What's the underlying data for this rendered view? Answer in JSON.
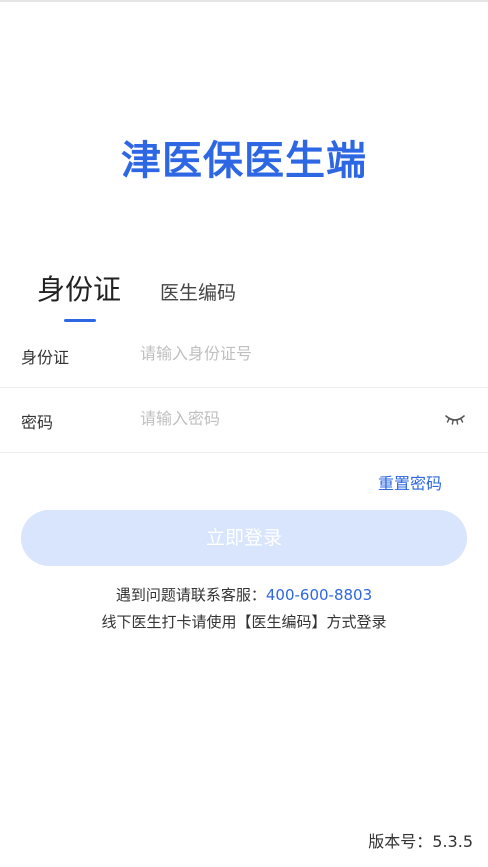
{
  "app": {
    "title": "津医保医生端"
  },
  "tabs": [
    {
      "label": "身份证",
      "active": true
    },
    {
      "label": "医生编码",
      "active": false
    }
  ],
  "form": {
    "id_row": {
      "label": "身份证",
      "placeholder": "请输入身份证号",
      "value": ""
    },
    "password_row": {
      "label": "密码",
      "placeholder": "请输入密码",
      "value": "",
      "toggle_icon": "eye-closed-icon"
    }
  },
  "reset_password_label": "重置密码",
  "login_button_label": "立即登录",
  "help": {
    "prefix": "遇到问题请联系客服：",
    "phone": "400-600-8803",
    "note": "线下医生打卡请使用【医生编码】方式登录"
  },
  "version": {
    "label": "版本号：5.3.5"
  },
  "colors": {
    "accent": "#2e67e3",
    "button_disabled_bg": "#d8e5fd",
    "placeholder": "#bfbfbf",
    "divider": "#eeeeee"
  }
}
